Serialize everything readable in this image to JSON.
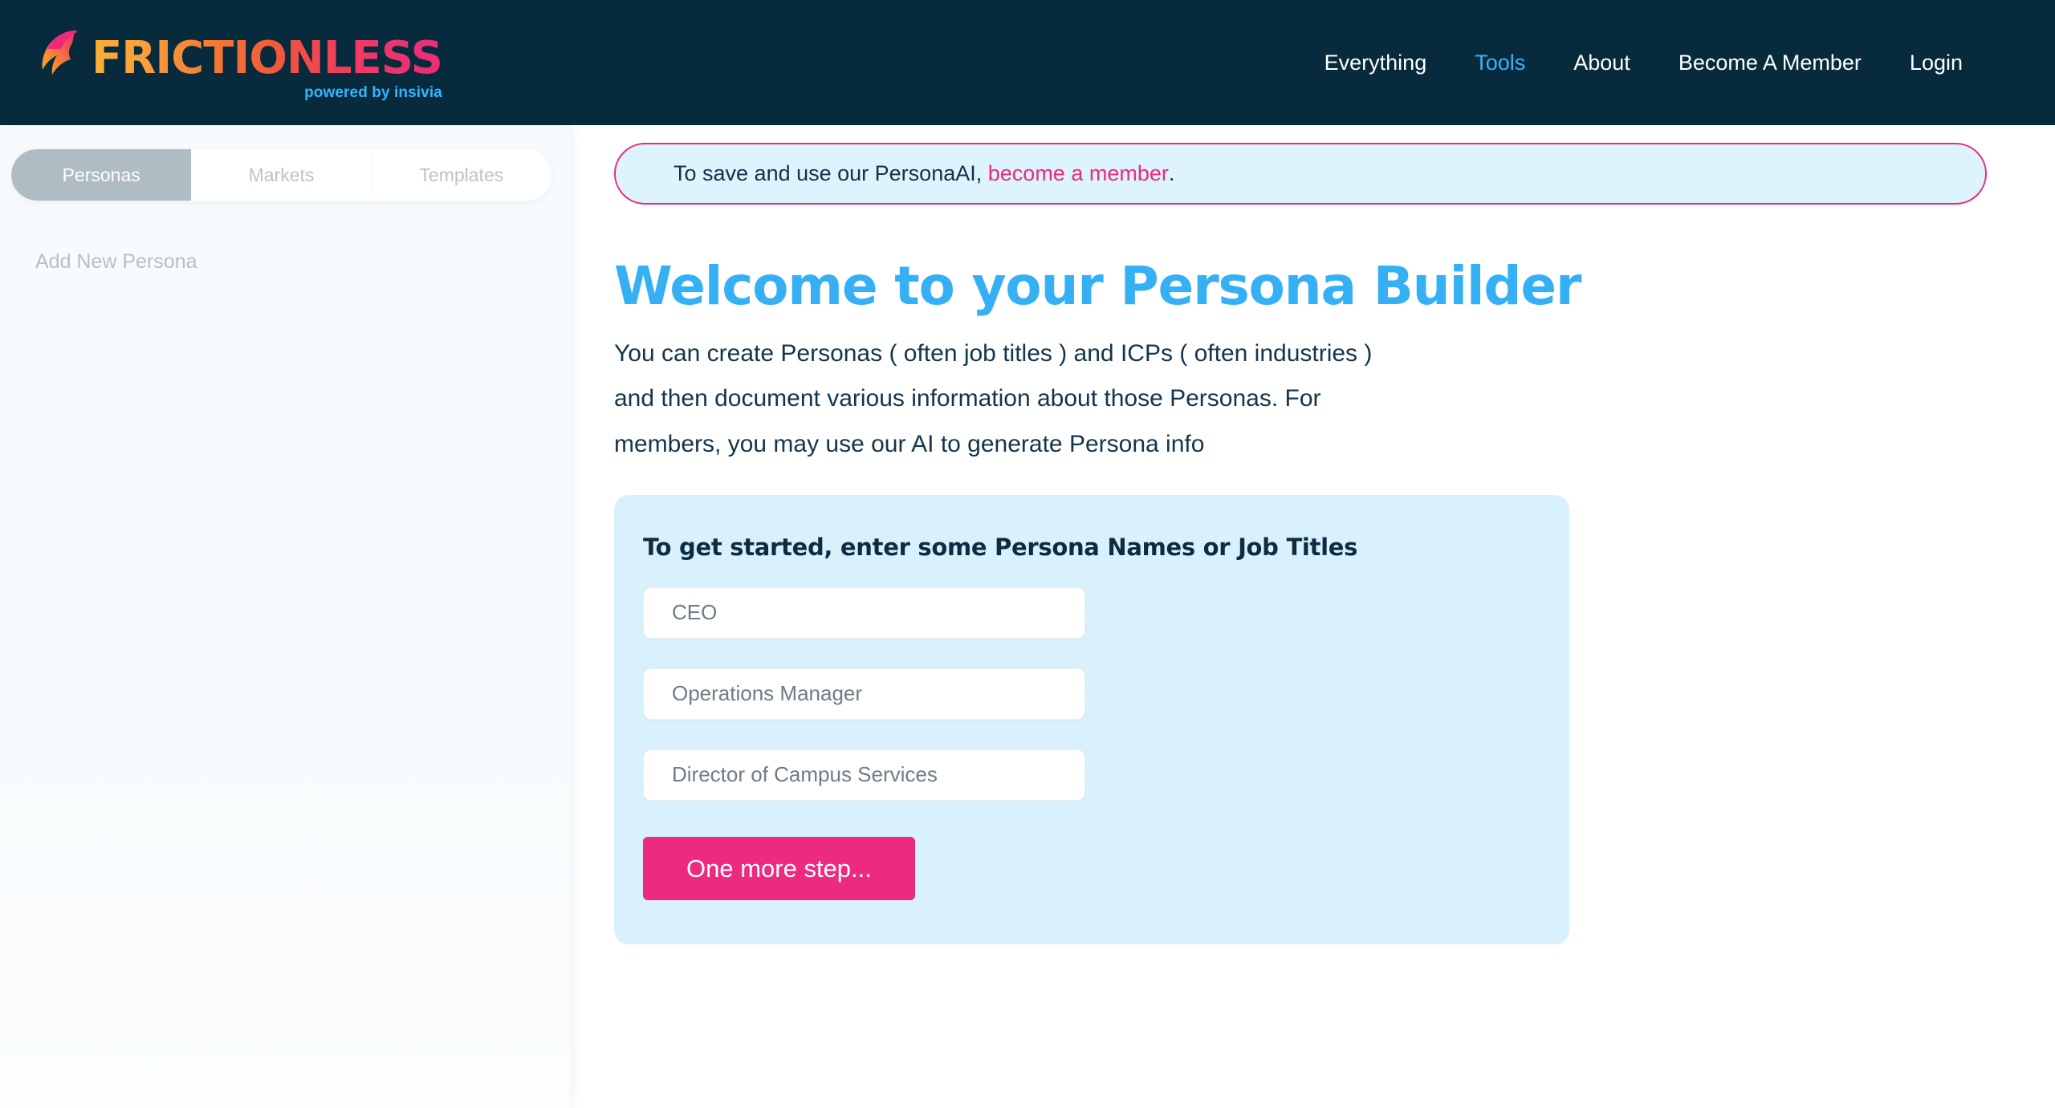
{
  "header": {
    "brand": {
      "word": "FRICTIONLESS",
      "tagline": "powered by insivia",
      "mark_icon": "frictionless-f-logo-icon"
    },
    "nav": [
      {
        "label": "Everything",
        "active": false
      },
      {
        "label": "Tools",
        "active": true
      },
      {
        "label": "About",
        "active": false
      },
      {
        "label": "Become A Member",
        "active": false
      },
      {
        "label": "Login",
        "active": false
      }
    ]
  },
  "sidebar": {
    "tabs": [
      {
        "label": "Personas",
        "active": true
      },
      {
        "label": "Markets",
        "active": false
      },
      {
        "label": "Templates",
        "active": false
      }
    ],
    "add_new_label": "Add New Persona"
  },
  "banner": {
    "text_before": "To save and use our PersonaAI,",
    "link_label": "become a member",
    "text_after": "."
  },
  "main": {
    "title": "Welcome to your Persona Builder",
    "paragraph_line_1": "You can create Personas ( often job titles ) and ICPs ( often industries )",
    "paragraph_line_2": "and then document various information about those Personas. For",
    "paragraph_line_3": "members, you may use our AI to generate Persona info",
    "form": {
      "title": "To get started, enter some Persona Names or Job Titles",
      "fields": [
        {
          "value": "",
          "placeholder": "CEO"
        },
        {
          "value": "",
          "placeholder": "Operations Manager"
        },
        {
          "value": "",
          "placeholder": "Director of Campus Services"
        }
      ],
      "submit_label": "One more step..."
    }
  },
  "colors": {
    "header_bg": "#072b3d",
    "accent_pink": "#ec2a80",
    "accent_blue": "#36b0f4",
    "banner_bg": "#ddf4fd",
    "card_bg": "#d9f1fc",
    "tab_active_bg": "#b0bcc3"
  }
}
